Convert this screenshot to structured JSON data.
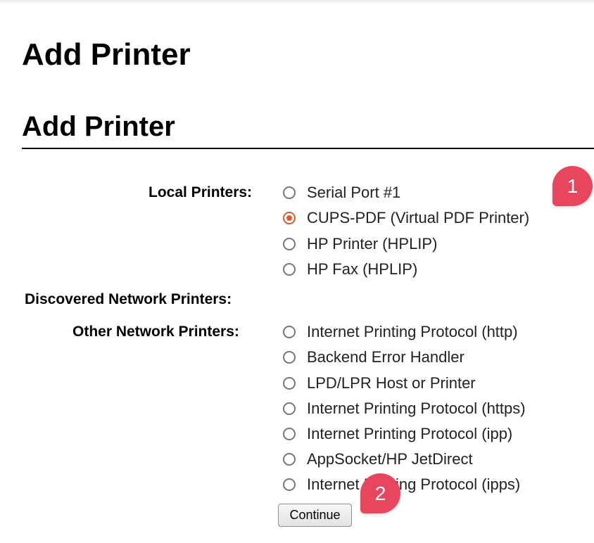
{
  "page": {
    "title": "Add Printer",
    "section_title": "Add Printer"
  },
  "form": {
    "local_printers_label": "Local Printers:",
    "local_printers": [
      {
        "label": "Serial Port #1",
        "checked": false
      },
      {
        "label": "CUPS-PDF (Virtual PDF Printer)",
        "checked": true
      },
      {
        "label": "HP Printer (HPLIP)",
        "checked": false
      },
      {
        "label": "HP Fax (HPLIP)",
        "checked": false
      }
    ],
    "discovered_network_printers_label": "Discovered Network Printers:",
    "other_network_printers_label": "Other Network Printers:",
    "other_network_printers": [
      {
        "label": "Internet Printing Protocol (http)",
        "checked": false
      },
      {
        "label": "Backend Error Handler",
        "checked": false
      },
      {
        "label": "LPD/LPR Host or Printer",
        "checked": false
      },
      {
        "label": "Internet Printing Protocol (https)",
        "checked": false
      },
      {
        "label": "Internet Printing Protocol (ipp)",
        "checked": false
      },
      {
        "label": "AppSocket/HP JetDirect",
        "checked": false
      },
      {
        "label": "Internet Printing Protocol (ipps)",
        "checked": false
      }
    ],
    "continue_label": "Continue"
  },
  "annotations": [
    {
      "label": "1"
    },
    {
      "label": "2"
    }
  ],
  "colors": {
    "radio_checked": "#e0582d",
    "marker": "#e8455f"
  },
  "icons": {
    "radio_unchecked": "radio-unchecked-icon",
    "radio_checked": "radio-checked-icon"
  }
}
